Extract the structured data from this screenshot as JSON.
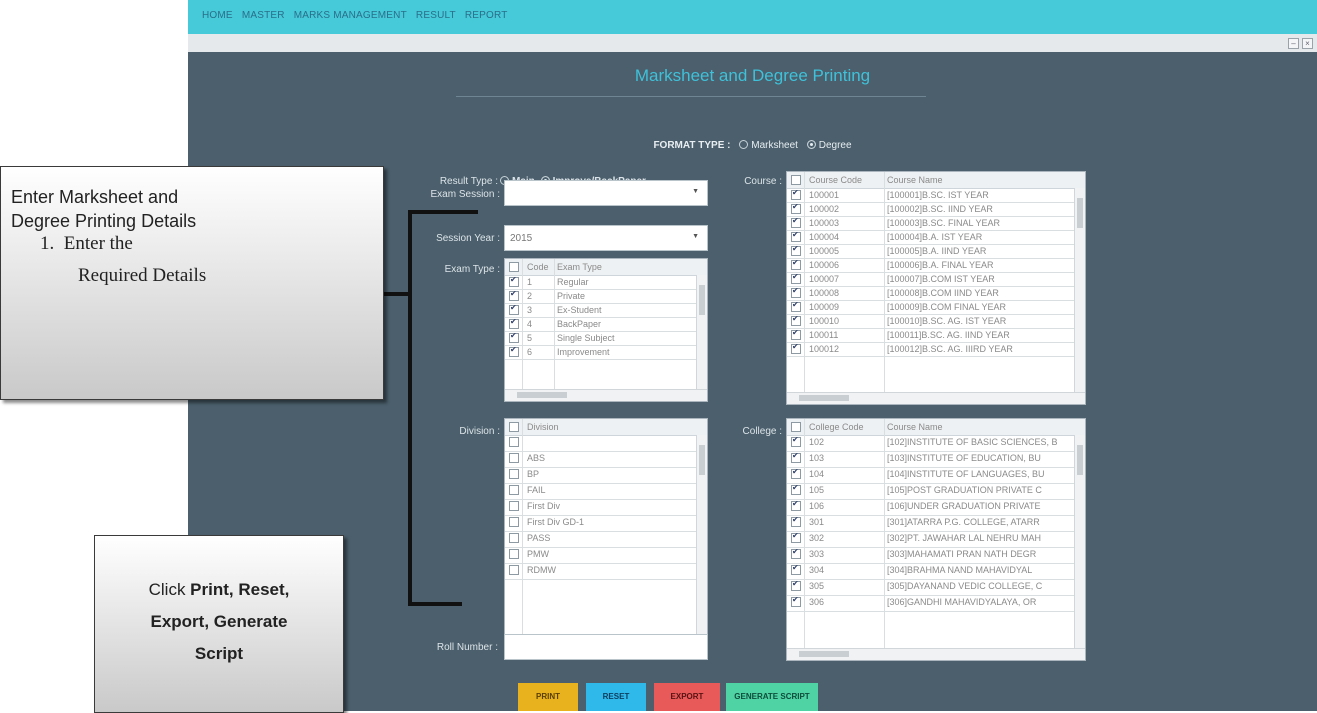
{
  "menu": [
    "HOME",
    "MASTER",
    "MARKS MANAGEMENT",
    "RESULT",
    "REPORT"
  ],
  "page_title": "Marksheet and Degree Printing",
  "format_type": {
    "label": "FORMAT TYPE :",
    "options": [
      "Marksheet",
      "Degree"
    ],
    "selected": "Degree"
  },
  "result_type": {
    "label": "Result Type :",
    "options": [
      "Main",
      "Improve/BackPaper"
    ],
    "selected": "Improve/BackPaper"
  },
  "exam_session": {
    "label": "Exam Session :",
    "value": ""
  },
  "session_year": {
    "label": "Session Year :",
    "value": "2015"
  },
  "exam_type": {
    "label": "Exam Type :",
    "columns": [
      "Code",
      "Exam Type"
    ],
    "rows": [
      {
        "code": "1",
        "name": "Regular",
        "checked": true
      },
      {
        "code": "2",
        "name": "Private",
        "checked": true
      },
      {
        "code": "3",
        "name": "Ex-Student",
        "checked": true
      },
      {
        "code": "4",
        "name": "BackPaper",
        "checked": true
      },
      {
        "code": "5",
        "name": "Single Subject",
        "checked": true
      },
      {
        "code": "6",
        "name": "Improvement",
        "checked": true
      }
    ]
  },
  "division": {
    "label": "Division :",
    "columns": [
      "Division"
    ],
    "rows": [
      {
        "name": "",
        "checked": false
      },
      {
        "name": "ABS",
        "checked": false
      },
      {
        "name": "BP",
        "checked": false
      },
      {
        "name": "FAIL",
        "checked": false
      },
      {
        "name": "First Div",
        "checked": false
      },
      {
        "name": "First Div GD-1",
        "checked": false
      },
      {
        "name": "PASS",
        "checked": false
      },
      {
        "name": "PMW",
        "checked": false
      },
      {
        "name": "RDMW",
        "checked": false
      }
    ]
  },
  "course": {
    "label": "Course :",
    "columns": [
      "Course Code",
      "Course Name"
    ],
    "rows": [
      {
        "code": "100001",
        "name": "[100001]B.SC. IST YEAR",
        "checked": true
      },
      {
        "code": "100002",
        "name": "[100002]B.SC. IIND YEAR",
        "checked": true
      },
      {
        "code": "100003",
        "name": "[100003]B.SC. FINAL YEAR",
        "checked": true
      },
      {
        "code": "100004",
        "name": "[100004]B.A. IST YEAR",
        "checked": true
      },
      {
        "code": "100005",
        "name": "[100005]B.A. IIND YEAR",
        "checked": true
      },
      {
        "code": "100006",
        "name": "[100006]B.A. FINAL YEAR",
        "checked": true
      },
      {
        "code": "100007",
        "name": "[100007]B.COM IST YEAR",
        "checked": true
      },
      {
        "code": "100008",
        "name": "[100008]B.COM IIND YEAR",
        "checked": true
      },
      {
        "code": "100009",
        "name": "[100009]B.COM FINAL YEAR",
        "checked": true
      },
      {
        "code": "100010",
        "name": "[100010]B.SC. AG. IST YEAR",
        "checked": true
      },
      {
        "code": "100011",
        "name": "[100011]B.SC. AG. IIND YEAR",
        "checked": true
      },
      {
        "code": "100012",
        "name": "[100012]B.SC. AG. IIIRD YEAR",
        "checked": true
      }
    ]
  },
  "college": {
    "label": "College :",
    "columns": [
      "College Code",
      "Course Name"
    ],
    "rows": [
      {
        "code": "102",
        "name": "[102]INSTITUTE OF BASIC SCIENCES, B",
        "checked": true
      },
      {
        "code": "103",
        "name": "[103]INSTITUTE OF EDUCATION, BU",
        "checked": true
      },
      {
        "code": "104",
        "name": "[104]INSTITUTE OF LANGUAGES, BU",
        "checked": true
      },
      {
        "code": "105",
        "name": "[105]POST GRADUATION PRIVATE C",
        "checked": true
      },
      {
        "code": "106",
        "name": "[106]UNDER GRADUATION PRIVATE",
        "checked": true
      },
      {
        "code": "301",
        "name": "[301]ATARRA P.G. COLLEGE, ATARR",
        "checked": true
      },
      {
        "code": "302",
        "name": "[302]PT. JAWAHAR LAL NEHRU MAH",
        "checked": true
      },
      {
        "code": "303",
        "name": "[303]MAHAMATI PRAN NATH DEGR",
        "checked": true
      },
      {
        "code": "304",
        "name": "[304]BRAHMA NAND MAHAVIDYAL",
        "checked": true
      },
      {
        "code": "305",
        "name": "[305]DAYANAND VEDIC COLLEGE, C",
        "checked": true
      },
      {
        "code": "306",
        "name": "[306]GANDHI MAHAVIDYALAYA, OR",
        "checked": true
      }
    ]
  },
  "roll_number": {
    "label": "Roll Number :",
    "value": ""
  },
  "buttons": [
    {
      "label": "PRINT",
      "color": "#e8b21f"
    },
    {
      "label": "RESET",
      "color": "#2fb8ea"
    },
    {
      "label": "EXPORT",
      "color": "#e85a5a"
    },
    {
      "label": "GENERATE SCRIPT",
      "color": "#4fd2a4"
    }
  ],
  "annotation1": {
    "heading_line1": "Enter Marksheet and",
    "heading_line2": "Degree Printing Details",
    "item_number": "1.",
    "item_line1": "Enter the",
    "item_line2": "Required Details"
  },
  "annotation2": {
    "pre": "Click ",
    "bold1": "Print, Reset,",
    "bold2": "Export, Generate",
    "bold3": "Script"
  }
}
